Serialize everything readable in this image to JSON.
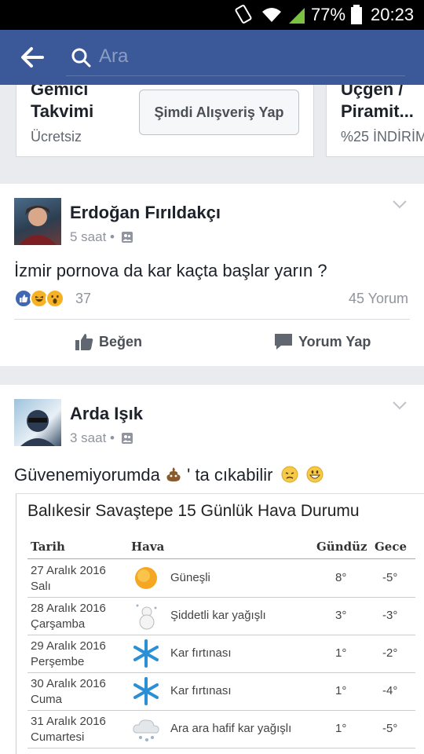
{
  "status_bar": {
    "battery": "77%",
    "time": "20:23"
  },
  "app_bar": {
    "search_placeholder": "Ara"
  },
  "shop_strip": {
    "left_card": {
      "title_line1": "Gemici",
      "title_line2": "Takvimi",
      "price": "Ücretsiz",
      "button": "Şimdi Alışveriş Yap"
    },
    "right_card": {
      "title_line1": "Üçgen /",
      "title_line2": "Piramit...",
      "discount": "%25 İNDİRİM"
    }
  },
  "posts": [
    {
      "author": "Erdoğan Fırıldakçı",
      "time": "5 saat",
      "text": "İzmir pornova da kar kaçta başlar yarın ?",
      "reaction_count": "37",
      "comment_count": "45 Yorum",
      "like_label": "Beğen",
      "comment_label": "Yorum Yap"
    },
    {
      "author": "Arda Işık",
      "time": "3 saat",
      "text": "Güvenemiyorumda",
      "text_suffix": "' ta cıkabilir"
    }
  ],
  "weather_image": {
    "title": "Balıkesir Savaştepe 15 Günlük Hava Durumu",
    "headers": {
      "date": "Tarih",
      "weather": "Hava",
      "day": "Gündüz",
      "night": "Gece"
    },
    "rows": [
      {
        "date": "27 Aralık 2016",
        "weekday": "Salı",
        "condition": "Güneşli",
        "icon": "sun-icon",
        "day": "8°",
        "night": "-5°"
      },
      {
        "date": "28 Aralık 2016",
        "weekday": "Çarşamba",
        "condition": "Şiddetli kar yağışlı",
        "icon": "snowman-icon",
        "day": "3°",
        "night": "-3°"
      },
      {
        "date": "29 Aralık 2016",
        "weekday": "Perşembe",
        "condition": "Kar fırtınası",
        "icon": "snowflake-icon",
        "day": "1°",
        "night": "-2°"
      },
      {
        "date": "30 Aralık 2016",
        "weekday": "Cuma",
        "condition": "Kar fırtınası",
        "icon": "snowflake-icon",
        "day": "1°",
        "night": "-4°"
      },
      {
        "date": "31 Aralık 2016",
        "weekday": "Cumartesi",
        "condition": "Ara ara hafif kar yağışlı",
        "icon": "cloud-snow-icon",
        "day": "1°",
        "night": "-5°"
      }
    ]
  },
  "colors": {
    "facebook_blue": "#3b5998",
    "sun": "#f5a623",
    "snowflake": "#2b8fd6"
  }
}
